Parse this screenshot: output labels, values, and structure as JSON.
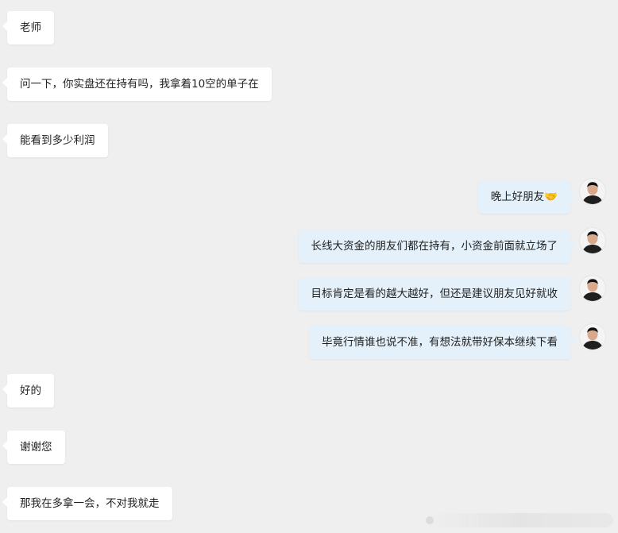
{
  "messages": [
    {
      "side": "left",
      "text": "老师"
    },
    {
      "side": "left",
      "text": "问一下，你实盘还在持有吗，我拿着10空的单子在"
    },
    {
      "side": "left",
      "text": "能看到多少利润"
    },
    {
      "side": "right",
      "text": "晚上好朋友🤝"
    },
    {
      "side": "right",
      "text": "长线大资金的朋友们都在持有，小资金前面就立场了"
    },
    {
      "side": "right",
      "text": "目标肯定是看的越大越好，但还是建议朋友见好就收"
    },
    {
      "side": "right",
      "text": "毕竟行情谁也说不准，有想法就带好保本继续下看"
    },
    {
      "side": "left",
      "text": "好的"
    },
    {
      "side": "left",
      "text": "谢谢您"
    },
    {
      "side": "left",
      "text": "那我在多拿一会，不对我就走"
    }
  ],
  "colors": {
    "background": "#efefef",
    "incoming_bubble": "#ffffff",
    "outgoing_bubble": "#e4f1fb"
  },
  "icons": {
    "avatar": "user-avatar-icon"
  }
}
